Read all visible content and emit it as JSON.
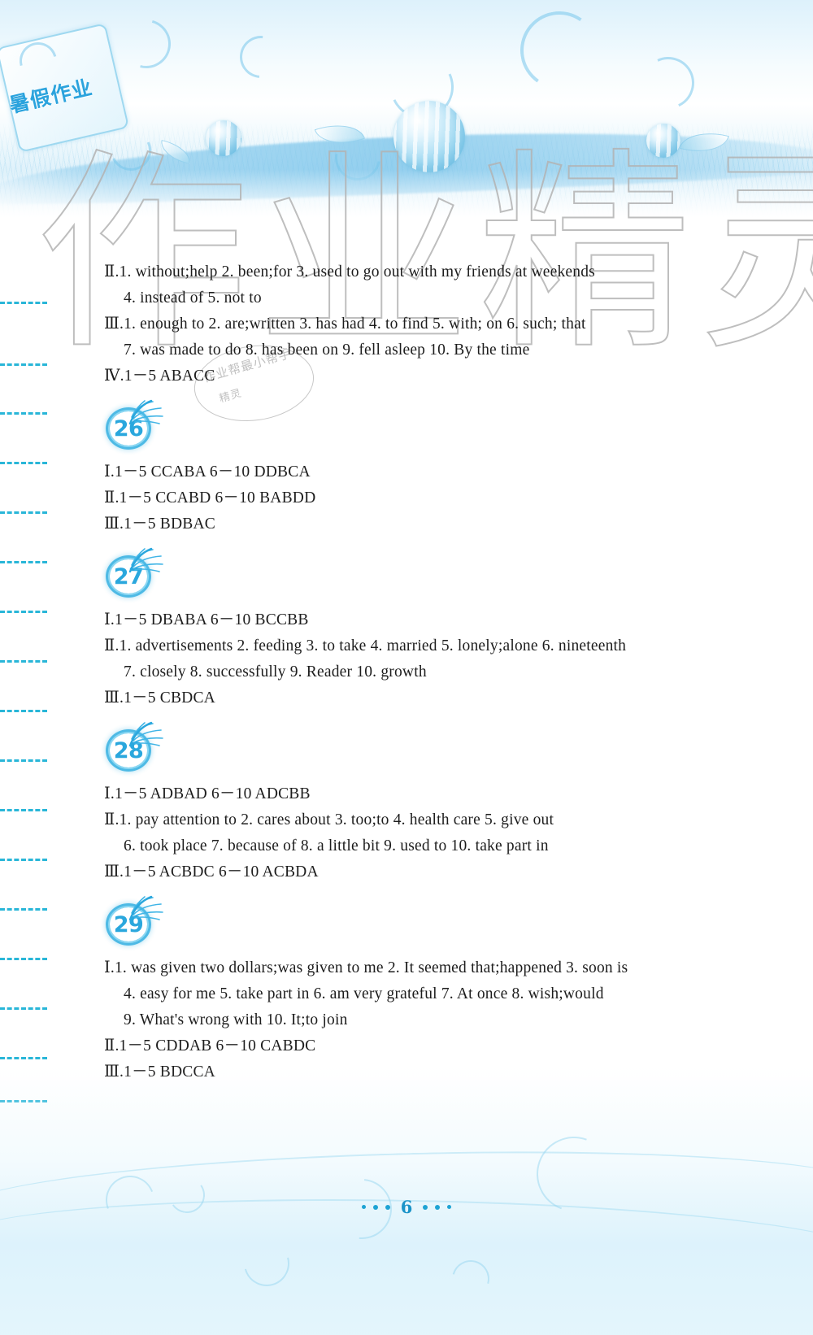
{
  "document": {
    "cover_title": "暑假作业",
    "watermark_large": "作业精灵",
    "watermark_stamp_line1": "作业帮最小帮手",
    "watermark_stamp_line2": "精灵",
    "page_number": "6"
  },
  "answers": {
    "intro_lines": [
      {
        "id": "intro-l1",
        "text": "Ⅱ.1. without;help   2. been;for   3. used to go out with my friends at weekends",
        "indent": false
      },
      {
        "id": "intro-l2",
        "text": "4. instead of   5. not to",
        "indent": true
      },
      {
        "id": "intro-l3",
        "text": "Ⅲ.1. enough to   2. are;written   3. has had   4. to find   5. with; on   6. such; that",
        "indent": false
      },
      {
        "id": "intro-l4",
        "text": "7. was made to do   8. has been on   9. fell asleep   10. By the time",
        "indent": true
      },
      {
        "id": "intro-l5",
        "text": "Ⅳ.1－5 ABACC",
        "indent": false
      }
    ],
    "sections": [
      {
        "badge": "26",
        "lines": [
          {
            "text": "Ⅰ.1－5 CCABA   6－10 DDBCA",
            "indent": false
          },
          {
            "text": "Ⅱ.1－5 CCABD   6－10 BABDD",
            "indent": false
          },
          {
            "text": "Ⅲ.1－5 BDBAC",
            "indent": false
          }
        ]
      },
      {
        "badge": "27",
        "lines": [
          {
            "text": "Ⅰ.1－5 DBABA   6－10 BCCBB",
            "indent": false
          },
          {
            "text": "Ⅱ.1. advertisements   2. feeding   3. to take   4. married   5. lonely;alone   6. nineteenth",
            "indent": false
          },
          {
            "text": "7. closely   8. successfully   9. Reader   10. growth",
            "indent": true
          },
          {
            "text": "Ⅲ.1－5 CBDCA",
            "indent": false
          }
        ]
      },
      {
        "badge": "28",
        "lines": [
          {
            "text": "Ⅰ.1－5 ADBAD   6－10 ADCBB",
            "indent": false
          },
          {
            "text": "Ⅱ.1. pay attention to   2. cares about   3. too;to   4. health care   5. give out",
            "indent": false
          },
          {
            "text": "6. took place   7. because of   8. a little bit   9. used to   10. take part in",
            "indent": true
          },
          {
            "text": "Ⅲ.1－5 ACBDC   6－10 ACBDA",
            "indent": false
          }
        ]
      },
      {
        "badge": "29",
        "lines": [
          {
            "text": "Ⅰ.1. was given two dollars;was given to me   2. It seemed that;happened   3. soon is",
            "indent": false
          },
          {
            "text": "4. easy for me   5. take part in   6. am very grateful   7. At once   8. wish;would",
            "indent": true
          },
          {
            "text": "9. What's wrong with   10. It;to join",
            "indent": true
          },
          {
            "text": "Ⅱ.1－5 CDDAB   6－10 CABDC",
            "indent": false
          },
          {
            "text": "Ⅲ.1－5 BDCCA",
            "indent": false
          }
        ]
      }
    ]
  },
  "colors": {
    "accent_blue": "#2aa7dd",
    "dash_cyan": "#29b6d8",
    "text": "#1d1d1d",
    "watermark_gray": "#b3b3b3"
  }
}
